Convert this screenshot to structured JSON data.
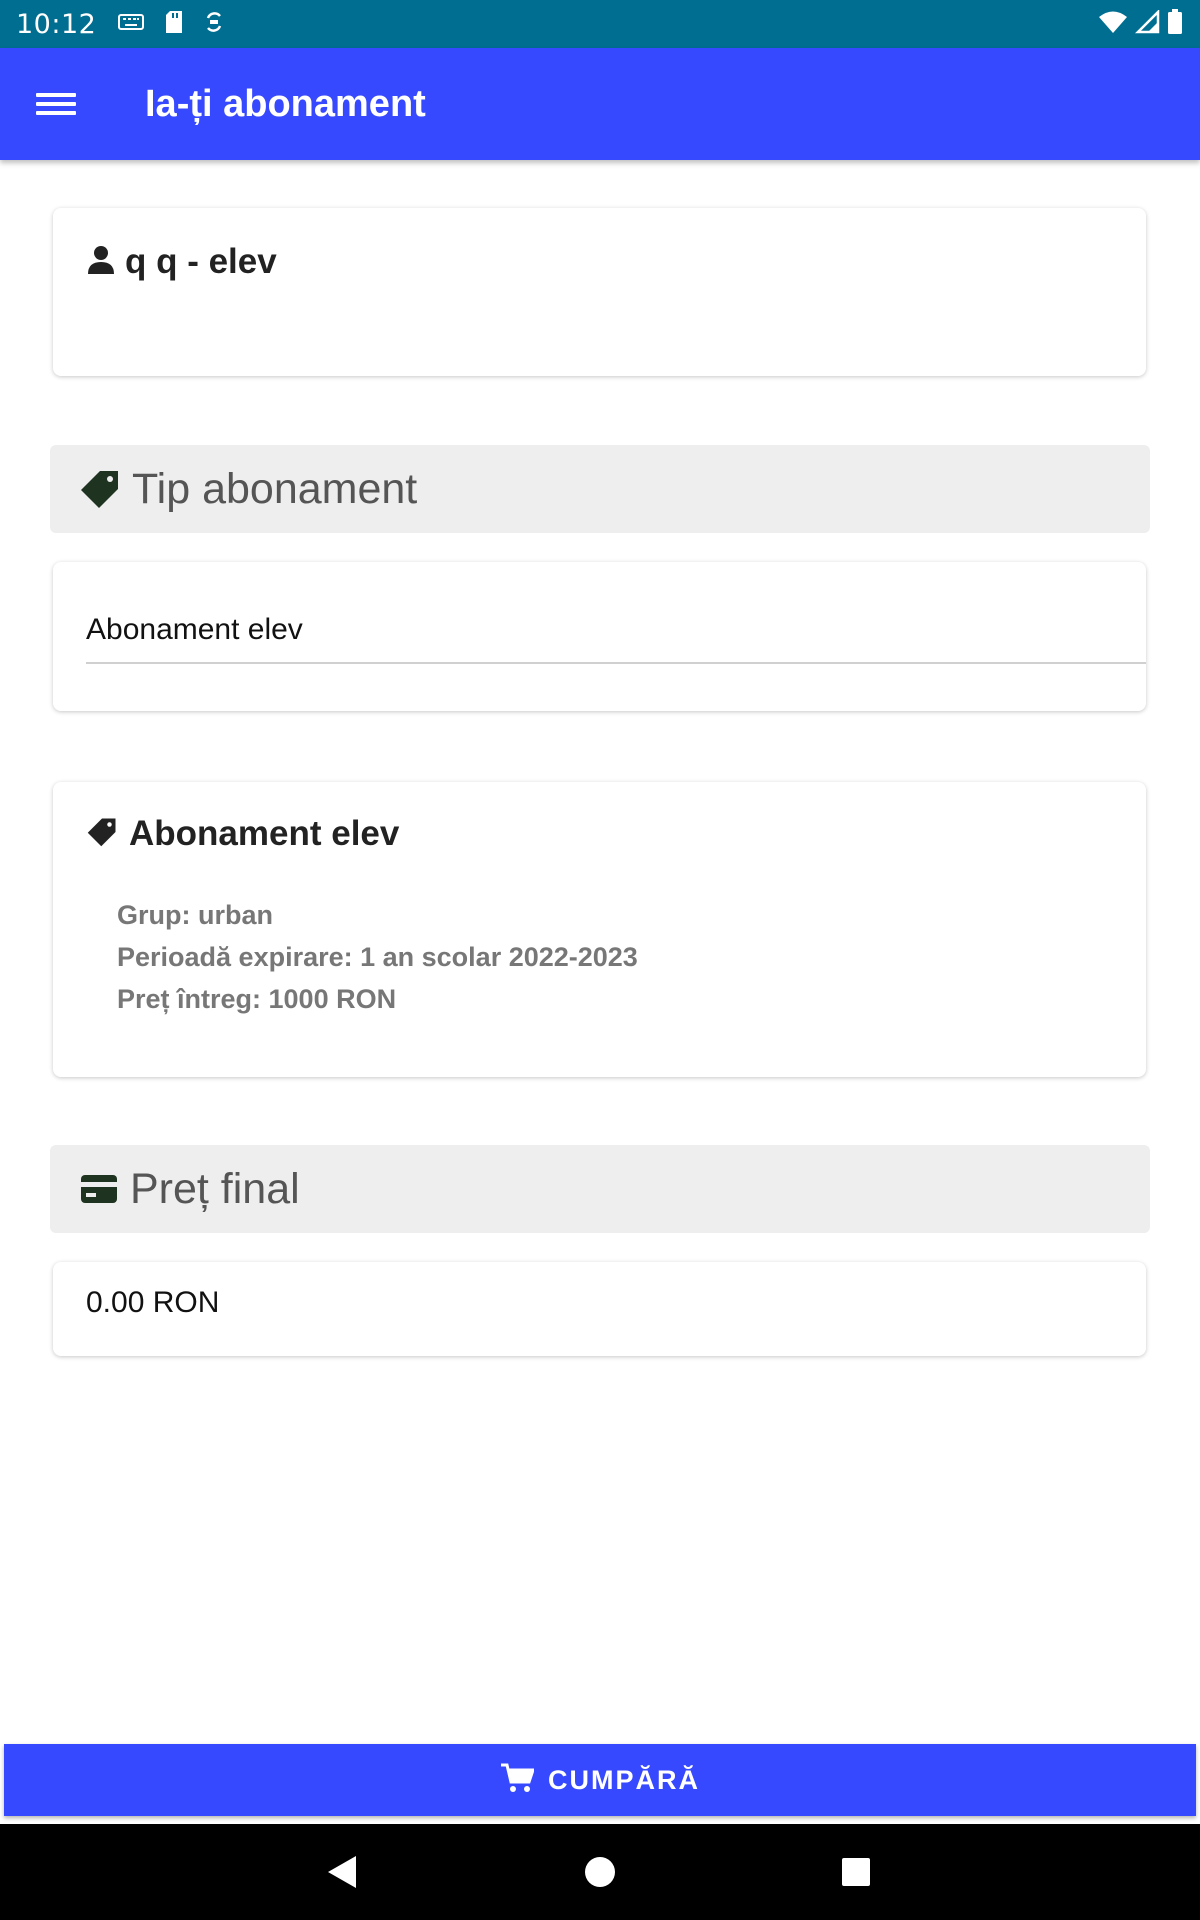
{
  "status_bar": {
    "time": "10:12",
    "left_icons": [
      "keyboard-icon",
      "sd-card-icon",
      "sync-icon"
    ],
    "right_icons": [
      "wifi-icon",
      "signal-icon",
      "battery-icon"
    ]
  },
  "app_bar": {
    "menu_icon": "hamburger-menu-icon",
    "title": "Ia-ți abonament"
  },
  "user": {
    "icon": "person-icon",
    "name": "q q - elev"
  },
  "subscription_type": {
    "header_icon": "tag-icon",
    "header_label": "Tip abonament",
    "selected": "Abonament elev"
  },
  "subscription_details": {
    "icon": "tag-icon",
    "title": "Abonament elev",
    "group": "Grup: urban",
    "expiry": "Perioadă expirare: 1 an scolar 2022-2023",
    "full_price": "Preț întreg: 1000 RON"
  },
  "final_price": {
    "header_icon": "credit-card-icon",
    "header_label": "Preț final",
    "value": "0.00 RON"
  },
  "buy_button": {
    "icon": "cart-icon",
    "label": "CUMPĂRĂ"
  },
  "colors": {
    "status_bar": "#006e91",
    "primary": "#3649ff",
    "section_header_bg": "#eeeeee",
    "icon_dark_green": "#1e3320"
  },
  "navigation": [
    "back-icon",
    "home-icon",
    "recents-icon"
  ]
}
